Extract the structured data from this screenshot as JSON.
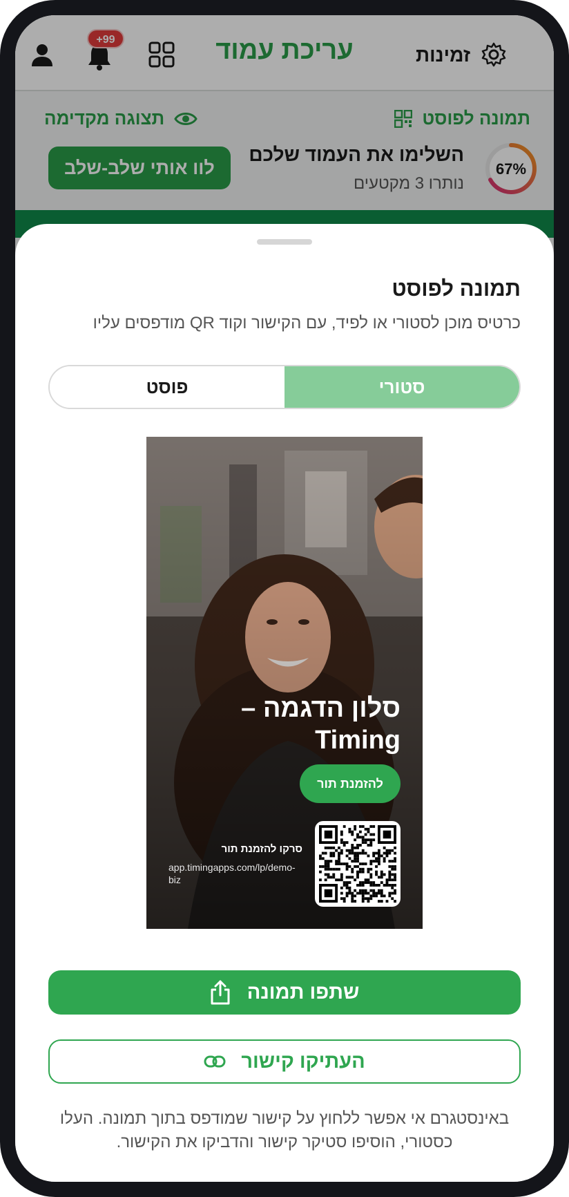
{
  "header": {
    "title": "עריכת עמוד",
    "right_label": "זמינות",
    "notification_badge": "+99",
    "icons": [
      "avatar-icon",
      "bell-icon",
      "apps-icon",
      "gear-icon"
    ]
  },
  "subbar": {
    "preview_label": "תצוגה מקדימה",
    "post_image_label": "תמונה לפוסט",
    "progress_title": "השלימו את העמוד שלכם",
    "progress_sub": "נותרו 3 מקטעים",
    "progress_percent": "67%",
    "progress_value": 0.67,
    "guide_button": "לוו אותי שלב-שלב"
  },
  "sheet": {
    "title": "תמונה לפוסט",
    "description": "כרטיס מוכן לסטורי או לפיד, עם הקישור וקוד QR מודפסים עליו",
    "tabs": [
      {
        "label": "פוסט",
        "selected": false
      },
      {
        "label": "סטורי",
        "selected": true
      }
    ],
    "card": {
      "business_name": "סלון הדגמה – Timing",
      "book_button": "להזמנת תור",
      "qr_caption": "סרקו להזמנת תור",
      "url": "app.timingapps.com/lp/demo-biz"
    },
    "share_button": "שתפו תמונה",
    "copy_button": "העתיקו קישור",
    "footnote": "באינסטגרם אי אפשר ללחוץ על קישור שמודפס בתוך תמונה. העלו כסטורי, הוסיפו סטיקר קישור והדביקו את הקישור."
  },
  "colors": {
    "accent": "#2fa650",
    "tab_selected": "#86cc99",
    "badge": "#e23b3b"
  }
}
